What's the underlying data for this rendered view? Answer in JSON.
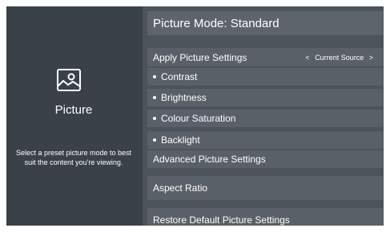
{
  "left_panel": {
    "icon": "picture-icon",
    "title": "Picture",
    "description": "Select a preset picture mode to best suit the content you're viewing."
  },
  "menu": {
    "picture_mode": "Picture Mode: Standard",
    "apply_settings": {
      "label": "Apply Picture Settings",
      "left_arrow": "<",
      "value": "Current Source",
      "right_arrow": ">"
    },
    "contrast": "Contrast",
    "brightness": "Brightness",
    "colour_saturation": "Colour Saturation",
    "backlight": "Backlight",
    "advanced": "Advanced Picture Settings",
    "aspect_ratio": "Aspect Ratio",
    "restore": "Restore Default Picture Settings"
  },
  "colors": {
    "background": "#3a4149",
    "menu_background": "#4d535a",
    "row_background": "#5a6067",
    "text": "#ffffff"
  }
}
